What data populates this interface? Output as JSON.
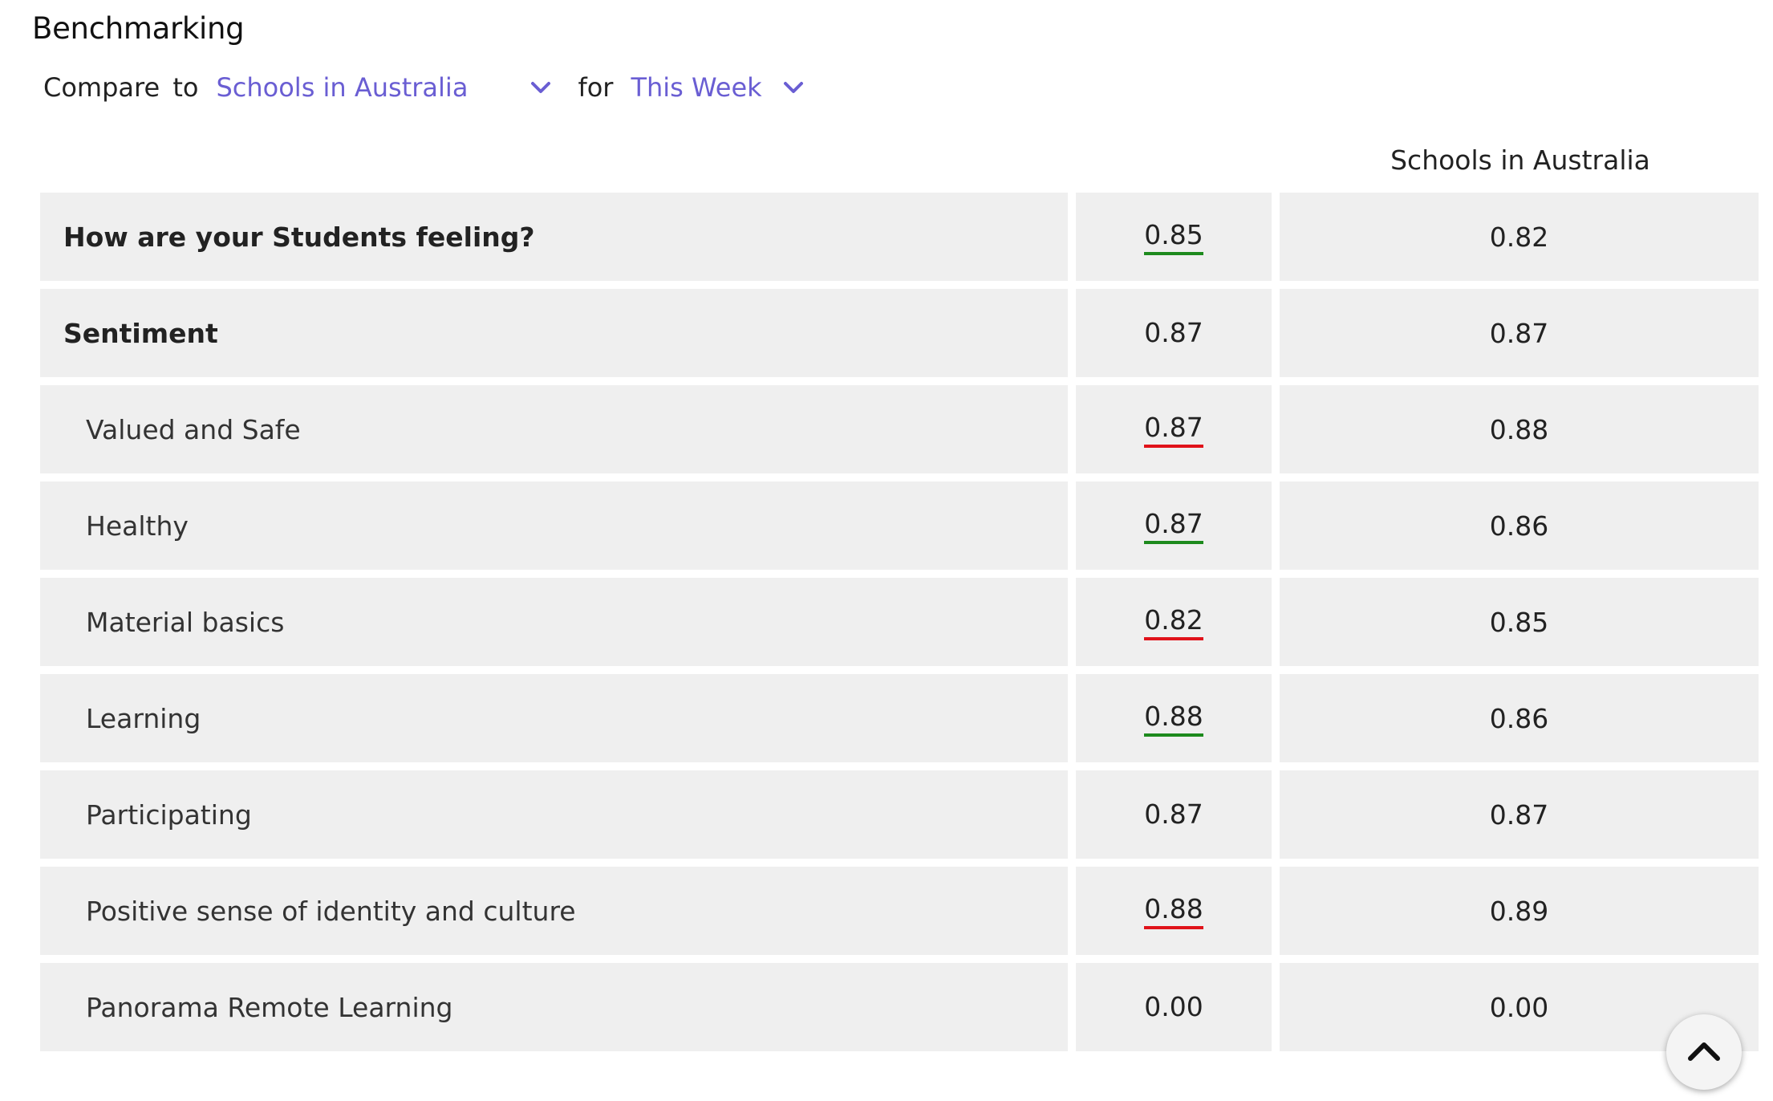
{
  "title": "Benchmarking",
  "controls": {
    "compare_label": "Compare to",
    "compare_value": "Schools in Australia",
    "for_label": "for",
    "period_value": "This Week"
  },
  "column_header": "Schools in Australia",
  "rows": [
    {
      "label": "How are your Students feeling?",
      "value": "0.85",
      "benchmark": "0.82",
      "trend": "up",
      "level": "top"
    },
    {
      "label": "Sentiment",
      "value": "0.87",
      "benchmark": "0.87",
      "trend": "none",
      "level": "top"
    },
    {
      "label": "Valued and Safe",
      "value": "0.87",
      "benchmark": "0.88",
      "trend": "down",
      "level": "sub"
    },
    {
      "label": "Healthy",
      "value": "0.87",
      "benchmark": "0.86",
      "trend": "up",
      "level": "sub"
    },
    {
      "label": "Material basics",
      "value": "0.82",
      "benchmark": "0.85",
      "trend": "down",
      "level": "sub"
    },
    {
      "label": "Learning",
      "value": "0.88",
      "benchmark": "0.86",
      "trend": "up",
      "level": "sub"
    },
    {
      "label": "Participating",
      "value": "0.87",
      "benchmark": "0.87",
      "trend": "none",
      "level": "sub"
    },
    {
      "label": "Positive sense of identity and culture",
      "value": "0.88",
      "benchmark": "0.89",
      "trend": "down",
      "level": "sub"
    },
    {
      "label": "Panorama Remote Learning",
      "value": "0.00",
      "benchmark": "0.00",
      "trend": "none",
      "level": "sub"
    }
  ],
  "colors": {
    "accent": "#6a5ed3",
    "above_benchmark": "#1d8a1d",
    "below_benchmark": "#e0121a",
    "row_background": "#efefef"
  },
  "icons": {
    "dropdown": "chevron-down-icon",
    "scroll_top": "chevron-up-icon"
  }
}
